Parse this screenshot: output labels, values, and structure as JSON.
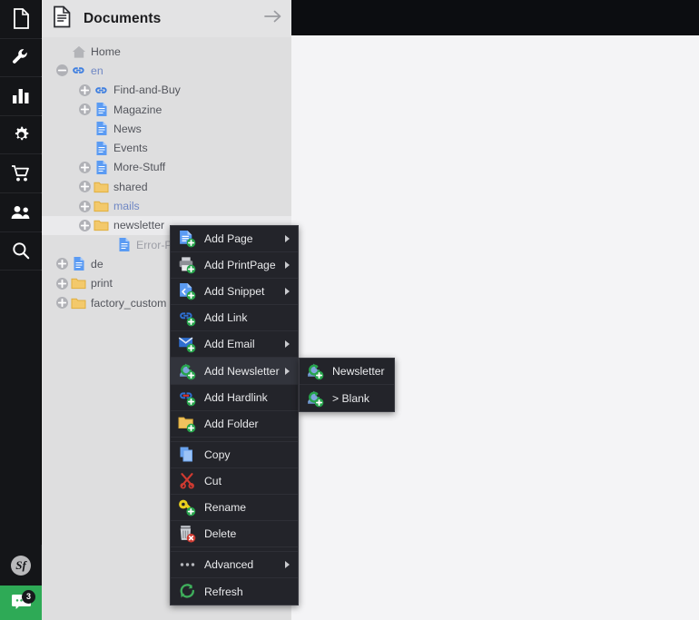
{
  "rail": {
    "items": [
      {
        "name": "documents",
        "icon": "document-icon",
        "active": true
      },
      {
        "name": "assets",
        "icon": "wrench-icon",
        "active": false
      },
      {
        "name": "reports",
        "icon": "bar-chart-icon",
        "active": false
      },
      {
        "name": "settings",
        "icon": "gear-icon",
        "active": false
      },
      {
        "name": "ecommerce",
        "icon": "shopping-cart-icon",
        "active": false
      },
      {
        "name": "customers",
        "icon": "users-icon",
        "active": false
      },
      {
        "name": "search",
        "icon": "search-icon",
        "active": false
      }
    ],
    "symfony_logo_text": "Sf",
    "chat_badge_count": "3"
  },
  "panel": {
    "title": "Documents",
    "header_icon": "document-icon",
    "collapse_icon": "arrow-right-icon",
    "tree": [
      {
        "label": "Home",
        "indent": 0,
        "toggle": "none",
        "icon": "home-icon",
        "style": "normal"
      },
      {
        "label": "en",
        "indent": 0,
        "toggle": "collapse",
        "icon": "link-icon",
        "style": "link"
      },
      {
        "label": "Find-and-Buy",
        "indent": 1,
        "toggle": "expand",
        "icon": "link-icon",
        "style": "normal"
      },
      {
        "label": "Magazine",
        "indent": 1,
        "toggle": "expand",
        "icon": "page-icon",
        "style": "normal"
      },
      {
        "label": "News",
        "indent": 1,
        "toggle": "none",
        "icon": "page-icon",
        "style": "normal"
      },
      {
        "label": "Events",
        "indent": 1,
        "toggle": "none",
        "icon": "page-icon",
        "style": "normal"
      },
      {
        "label": "More-Stuff",
        "indent": 1,
        "toggle": "expand",
        "icon": "page-icon",
        "style": "normal"
      },
      {
        "label": "shared",
        "indent": 1,
        "toggle": "expand",
        "icon": "folder-icon",
        "style": "normal"
      },
      {
        "label": "mails",
        "indent": 1,
        "toggle": "expand",
        "icon": "folder-icon",
        "style": "link"
      },
      {
        "label": "newsletter",
        "indent": 1,
        "toggle": "expand",
        "icon": "folder-icon",
        "style": "normal",
        "selected": true
      },
      {
        "label": "Error-Page",
        "indent": 2,
        "toggle": "none",
        "icon": "page-icon",
        "style": "dim"
      },
      {
        "label": "de",
        "indent": 0,
        "toggle": "expand",
        "icon": "page-icon",
        "style": "normal"
      },
      {
        "label": "print",
        "indent": 0,
        "toggle": "expand",
        "icon": "folder-icon",
        "style": "normal"
      },
      {
        "label": "factory_custom",
        "indent": 0,
        "toggle": "expand",
        "icon": "folder-icon",
        "style": "normal"
      }
    ]
  },
  "context_menu": {
    "items": [
      {
        "label": "Add Page",
        "icon": "add-page-icon",
        "submenu": true,
        "highlighted": false,
        "gap_before": false
      },
      {
        "label": "Add PrintPage",
        "icon": "add-printpage-icon",
        "submenu": true,
        "highlighted": false,
        "gap_before": false
      },
      {
        "label": "Add Snippet",
        "icon": "add-snippet-icon",
        "submenu": true,
        "highlighted": false,
        "gap_before": false
      },
      {
        "label": "Add Link",
        "icon": "add-link-icon",
        "submenu": false,
        "highlighted": false,
        "gap_before": false
      },
      {
        "label": "Add Email",
        "icon": "add-email-icon",
        "submenu": true,
        "highlighted": false,
        "gap_before": false
      },
      {
        "label": "Add Newsletter",
        "icon": "add-newsletter-icon",
        "submenu": true,
        "highlighted": true,
        "gap_before": false
      },
      {
        "label": "Add Hardlink",
        "icon": "add-hardlink-icon",
        "submenu": false,
        "highlighted": false,
        "gap_before": false
      },
      {
        "label": "Add Folder",
        "icon": "add-folder-icon",
        "submenu": false,
        "highlighted": false,
        "gap_before": false
      },
      {
        "label": "Copy",
        "icon": "copy-icon",
        "submenu": false,
        "highlighted": false,
        "gap_before": true
      },
      {
        "label": "Cut",
        "icon": "cut-icon",
        "submenu": false,
        "highlighted": false,
        "gap_before": false
      },
      {
        "label": "Rename",
        "icon": "rename-icon",
        "submenu": false,
        "highlighted": false,
        "gap_before": false
      },
      {
        "label": "Delete",
        "icon": "delete-icon",
        "submenu": false,
        "highlighted": false,
        "gap_before": false
      },
      {
        "label": "Advanced",
        "icon": "more-dots-icon",
        "submenu": true,
        "highlighted": false,
        "gap_before": true
      },
      {
        "label": "Refresh",
        "icon": "refresh-icon",
        "submenu": false,
        "highlighted": false,
        "gap_before": false
      }
    ]
  },
  "submenu": {
    "items": [
      {
        "label": "Newsletter",
        "icon": "add-newsletter-icon"
      },
      {
        "label": "> Blank",
        "icon": "add-newsletter-icon"
      }
    ]
  },
  "colors": {
    "rail_bg": "#141518",
    "panel_bg": "#dededf",
    "menu_bg": "#23242a",
    "menu_highlight": "#32343c",
    "main_bg": "#f4f4f6",
    "topbar_bg": "#0c0d11",
    "accent_green": "#2eaa56",
    "link_blue": "#6f87c4"
  }
}
